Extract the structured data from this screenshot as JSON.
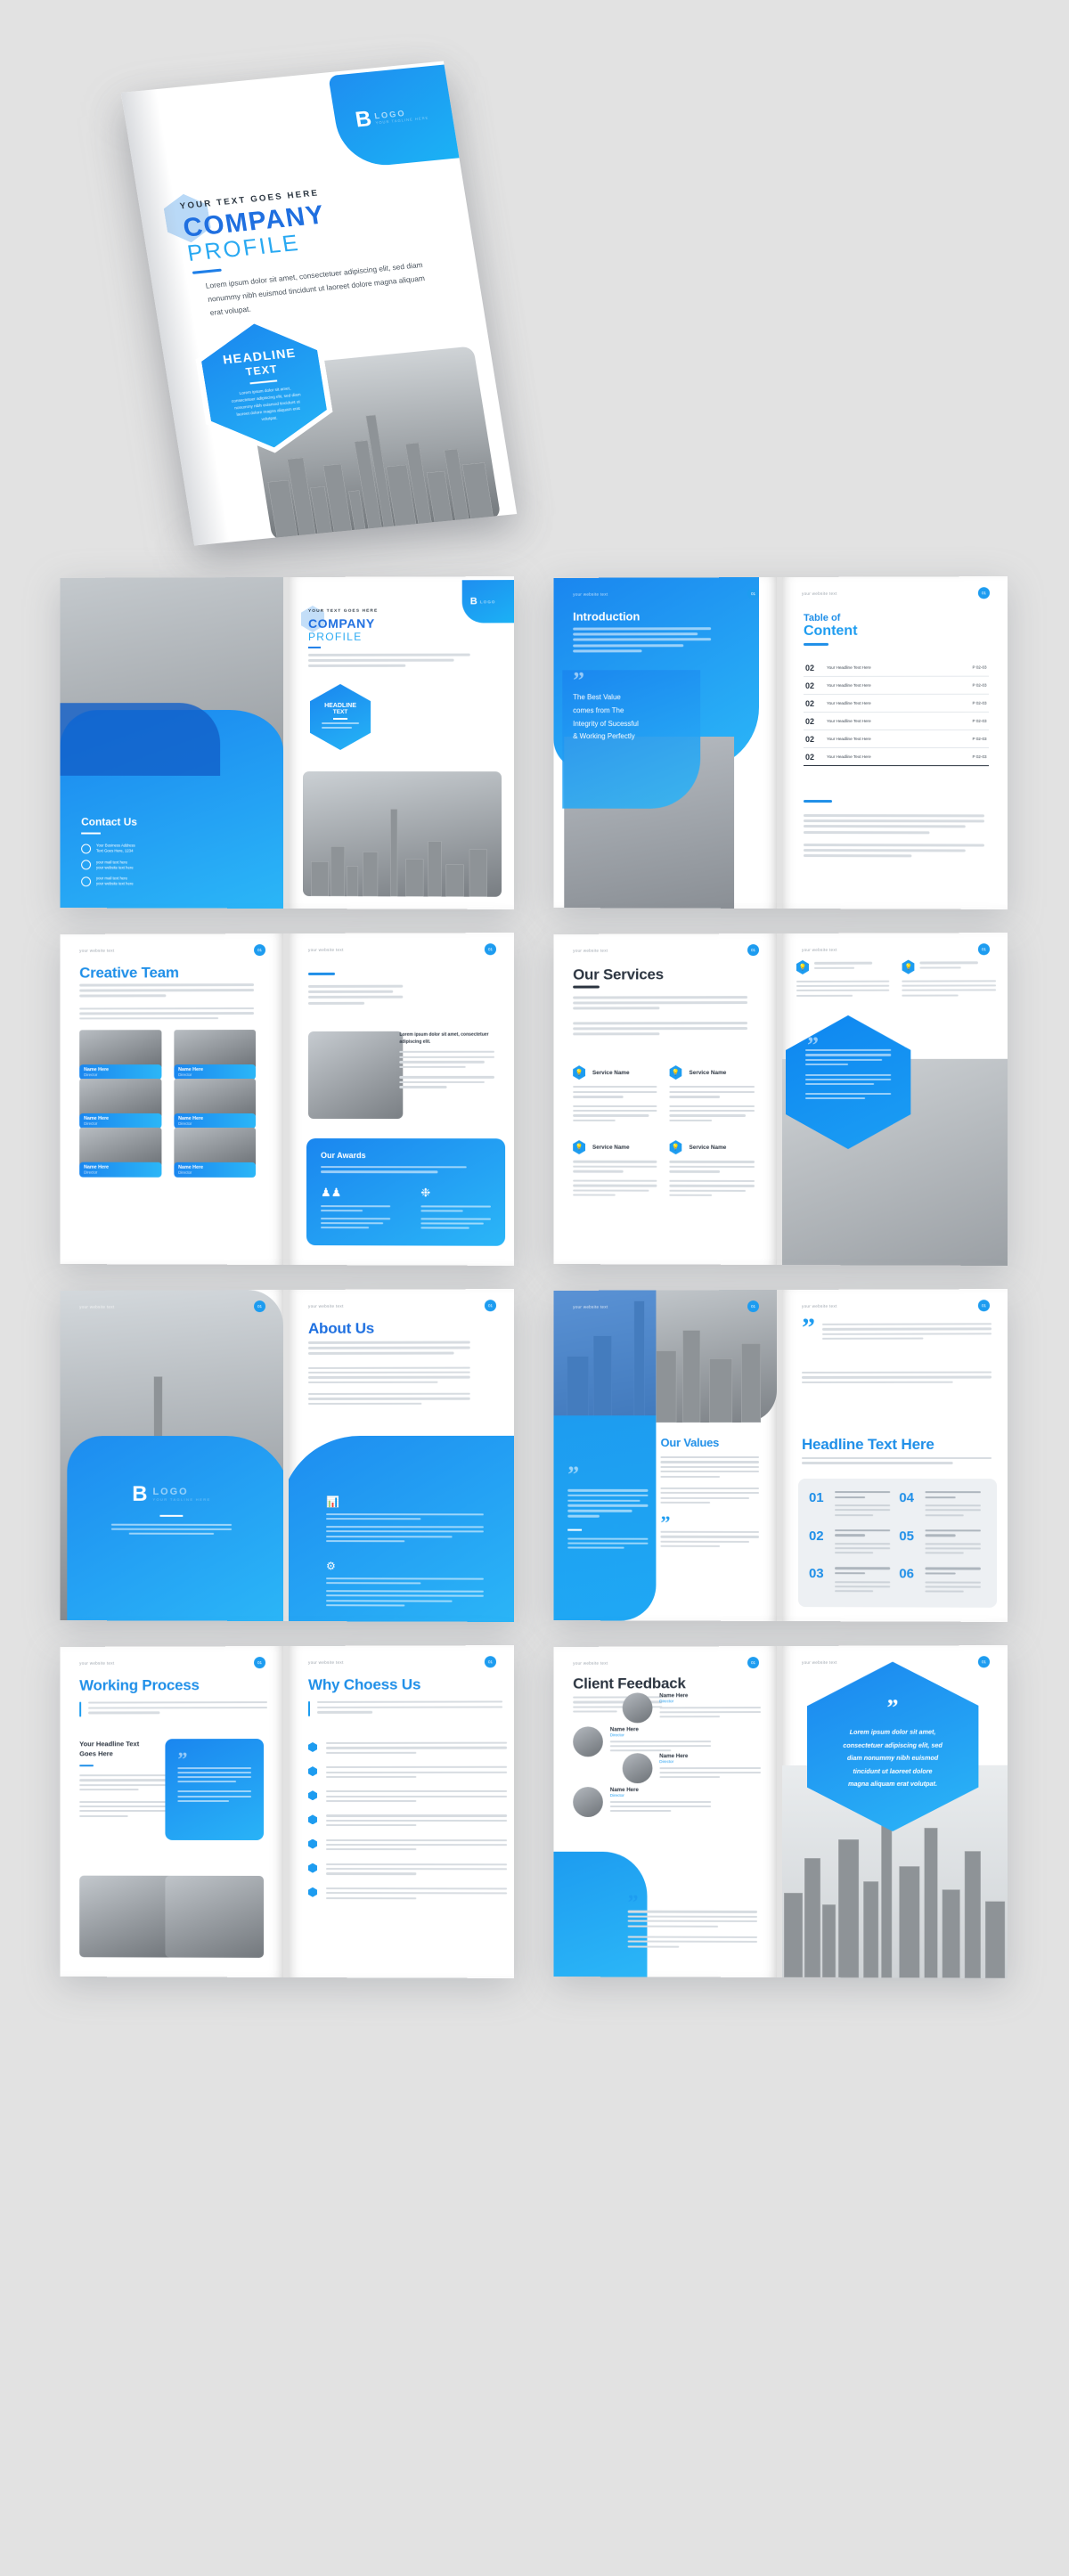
{
  "brand": {
    "primary": "#1f8fe8",
    "accent": "#25b4f6",
    "dark": "#2b3440",
    "logo_letter": "B",
    "logo_word": "LOGO",
    "logo_tagline": "YOUR TAGLINE HERE"
  },
  "cover": {
    "eyebrow": "YOUR TEXT GOES HERE",
    "title_line1": "COMPANY",
    "title_line2": "PROFILE",
    "body": "Lorem ipsum dolor sit amet, consectetuer adipiscing elit, sed diam nonummy nibh euismod tincidunt ut laoreet dolore magna aliquam erat volupat.",
    "headline_line1": "HEADLINE",
    "headline_line2": "TEXT",
    "headline_body": "Lorem ipsum dolor sit amet, consectetuer adipiscing elit, sed diam nonummy nibh euismod tincidunt ut laoreet dolore magna aliquam erat volutpat."
  },
  "common": {
    "website_text": "your website text",
    "page_number": "01"
  },
  "spreads": [
    {
      "id": "contact-cover",
      "left": {
        "name": "back-cover-contact",
        "title": "Contact Us",
        "items": [
          {
            "icon": "location-pin-icon",
            "line1": "Your Business Address",
            "line2": "Text Goes Here, 1234"
          },
          {
            "icon": "mail-icon",
            "line1": "your mail text here",
            "line2": "your website text here"
          },
          {
            "icon": "phone-icon",
            "line1": "your mail text here",
            "line2": "your website text here"
          }
        ]
      },
      "right": {
        "name": "front-cover",
        "eyebrow": "YOUR TEXT GOES HERE",
        "title_line1": "COMPANY",
        "title_line2": "PROFILE",
        "body": "Lorem ipsum dolor sit amet, consectetuer adipiscing elit, sed diam nonummy nibh euismod tincidunt ut laoreet dolore magna aliquam erat volutpat.",
        "headline_line1": "HEADLINE",
        "headline_line2": "TEXT",
        "logo_letter": "B",
        "logo_word": "LOGO"
      }
    },
    {
      "id": "introduction-toc",
      "left": {
        "name": "introduction-page",
        "title": "Introduction",
        "body": "Lorem ipsum dolor sit amet, consectetuer adipiscing elit, sed diam nonummy nibh euismod tincidunt ut laoreet dolore magna aliquam erat volutpat. Ut wisi enim ad minim veniam, quis nostrud exerci tation ullamcorper suscipit lobortis nisl ut aliquip ex ea commodo consequat.",
        "quote_line1": "The Best Value",
        "quote_line2": "comes from The",
        "quote_line3": "Integrity of Sucessful",
        "quote_line4": "& Working Perfectly"
      },
      "right": {
        "name": "table-of-content-page",
        "title_line1": "Table of",
        "title_line2": "Content",
        "rows": [
          {
            "num": "02",
            "title": "Your Headline Text Here",
            "page": "P 02-03"
          },
          {
            "num": "02",
            "title": "Your Headline Text Here",
            "page": "P 02-03"
          },
          {
            "num": "02",
            "title": "Your Headline Text Here",
            "page": "P 02-03"
          },
          {
            "num": "02",
            "title": "Your Headline Text Here",
            "page": "P 02-03"
          },
          {
            "num": "02",
            "title": "Your Headline Text Here",
            "page": "P 02-03"
          },
          {
            "num": "02",
            "title": "Your Headline Text Here",
            "page": "P 02-03"
          }
        ],
        "body1": "Lorem ipsum dolor sit amet, consectetuer adipiscing elit, sed diam nonummy nibh euismod tincidunt ut laoreet dolore magna aliquam erat volutpat.",
        "body2": "Lorem ipsum dolor sit amet, consectetuer adipiscing elit, sed diam nonummy nibh euismod tincidunt ut laoreet dolore magna aliquam erat volutpat."
      }
    },
    {
      "id": "team-awards",
      "left": {
        "name": "creative-team-page",
        "title": "Creative Team",
        "intro": "Lorem ipsum dolor sit amet, consectetuer adipiscing elit, sed diam nonummy nibh euismod tincidunt ut laoreet dolore magna aliquam erat volutpat, Ut wisi enim ad minim veniam.",
        "members": [
          {
            "name": "Name Here",
            "role": "Director"
          },
          {
            "name": "Name Here",
            "role": "Director"
          },
          {
            "name": "Name Here",
            "role": "Director"
          },
          {
            "name": "Name Here",
            "role": "Director"
          },
          {
            "name": "Name Here",
            "role": "Director"
          },
          {
            "name": "Name Here",
            "role": "Director"
          }
        ]
      },
      "right": {
        "name": "awards-page",
        "lead": "Lorem ipsum dolor sit amet, consectetuer adipiscing elit, sed diam nonummy nibh euismod tincidunt ut laoreet dolore magna aliquam erat volutpat",
        "side_heading": "Lorem ipsum dolor sit amet, consectetuer adipiscing elit.",
        "awards_title": "Our Awards",
        "awards_sub": "Lorem ipsum dolor sit amet, consectetuer adipiscing elit, sed diam nonummy nibh euismod tincidunt ut laoreet dolore magna aliquam erat volutpat.",
        "awards": [
          {
            "icon": "team-icon",
            "label": "Lorem ipsum dolor sit amet, consectetuer adipiscing elit"
          },
          {
            "icon": "award-badge-icon",
            "label": "Lorem ipsum dolor sit amet, consectetuer adipiscing elit"
          }
        ]
      }
    },
    {
      "id": "services-testimonial",
      "left": {
        "name": "our-services-page",
        "title": "Our Services",
        "body1": "Lorem ipsum dolor sit amet, consectetuer adipiscing elit, sed diam nonummy nibh euismod tincidunt ut laoreet dolore magna aliquam erat volutpat. Ut wisi enim ad minim veniam.",
        "body2": "Lorem ipsum dolor sit amet, consectetuer adipiscing elit, sed diam nonummy nibh euismod tincidunt ut laoreet dolore magna aliquam erat volutpat. Ut wisi enim ad minim veniam.",
        "services": [
          {
            "icon": "lightbulb-icon",
            "name": "Service Name"
          },
          {
            "icon": "lightbulb-icon",
            "name": "Service Name"
          },
          {
            "icon": "lightbulb-icon",
            "name": "Service Name"
          },
          {
            "icon": "lightbulb-icon",
            "name": "Service Name"
          }
        ]
      },
      "right": {
        "name": "testimonial-page",
        "cards": [
          {
            "icon": "lightbulb-icon",
            "label": "Lorem ipsum dolor sit amet, consectetuer adipiscing elit"
          },
          {
            "icon": "lightbulb-icon",
            "label": "Lorem ipsum dolor sit amet, consectetuer adipiscing elit"
          }
        ],
        "hex_quote": "Lorem ipsum dolor sit amet, consectetuer adipiscing elit, sed diam nonummy nibh euismod tincidunt ut laoreet dolore magna aliquam erat volutpat."
      }
    },
    {
      "id": "logo-about",
      "left": {
        "name": "logo-page",
        "logo_letter": "B",
        "logo_word": "LOGO",
        "logo_tagline": "YOUR TAGLINE HERE",
        "body": "Lorem ipsum dolor sit amet, consectetuer adipiscing elit, sed diam nonummy nibh euismod tincidunt ut laoreet dolore magna aliquam erat volutpat."
      },
      "right": {
        "name": "about-us-page",
        "title": "About Us",
        "lead": "Lorem ipsum dolor sit amet, consectetuer adipiscing elit, sed diam nonummy nibh euismod tincidunt ut laoreet dolore magna aliquam erat volutpat.",
        "features": [
          {
            "icon": "presentation-chart-icon",
            "label": "Lorem ipsum dolor sit amet, consectetuer adipiscing elit"
          },
          {
            "icon": "team-network-icon",
            "label": "Lorem ipsum dolor sit amet, consectetuer adipiscing elit"
          }
        ]
      }
    },
    {
      "id": "values-headline",
      "left": {
        "name": "our-values-page",
        "title": "Our Values",
        "quote": "Lorem ipsum dolor sit amet, consectetuer adipiscing elit, sed diam nonummy nibh euismod tincidunt ut laoreet dolore magna aliquam erat volutpat.",
        "body": "Lorem ipsum dolor sit amet, consectetuer adipiscing elit, sed diam nonummy nibh euismod tincidunt ut laoreet dolore magna aliquam erat volutpat."
      },
      "right": {
        "name": "headline-numbers-page",
        "title": "Headline Text Here",
        "intro": "Lorem ipsum dolor sit amet, consectetuer adipiscing elit, sed diam nonummy nibh euismod tincidunt ut laoreet dolore magna aliquam erat volutpat.",
        "items": [
          {
            "num": "01",
            "heading": "Lorem ipsum dolor sit amet, consectetuer adipiscing elit."
          },
          {
            "num": "02",
            "heading": "Lorem ipsum dolor sit amet, consectetuer adipiscing elit."
          },
          {
            "num": "03",
            "heading": "Lorem ipsum dolor sit amet, consectetuer adipiscing elit."
          },
          {
            "num": "04",
            "heading": "Lorem ipsum dolor sit amet, consectetuer adipiscing elit."
          },
          {
            "num": "05",
            "heading": "Lorem ipsum dolor sit amet, consectetuer adipiscing elit."
          },
          {
            "num": "06",
            "heading": "Lorem ipsum dolor sit amet, consectetuer adipiscing elit."
          }
        ]
      }
    },
    {
      "id": "process-why",
      "left": {
        "name": "working-process-page",
        "title": "Working Process",
        "lead": "Lorem ipsum dolor sit amet, consectetuer adipiscing elit, sed diam nonummy nibh euismod tincidunt ut laoreet dolore magna aliquam erat volutpat, Ut wisi enim ad minim veniam.",
        "sub_title_line1": "Your Headline Text",
        "sub_title_line2": "Goes Here",
        "quote_card": "Lorem ipsum dolor sit amet, consectetuer adipiscing elit, sed diam nonummy nibh euismod tincidunt ut laoreet dolore magna aliquam erat volutpat."
      },
      "right": {
        "name": "why-choose-us-page",
        "title": "Why Choess Us",
        "lead": "Lorem ipsum dolor sit amet, consectetuer adipiscing elit, sed diam nonummy nibh euismod tincidunt ut laoreet dolore magna aliquam erat volutpat, Ut wisi enim ad minim veniam.",
        "bullets": [
          "Lorem ipsum dolor sit amet, consectetuer adipiscing elit, sed diam nonummy nibh euismod tincidunt ut laoreet dolore magna aliquam erat volutpat.",
          "Lorem ipsum dolor sit amet, consectetuer adipiscing elit, sed diam nonummy nibh euismod tincidunt ut laoreet dolore magna aliquam erat volutpat.",
          "Lorem ipsum dolor sit amet, consectetuer adipiscing elit, sed diam nonummy nibh euismod tincidunt ut laoreet dolore magna aliquam erat volutpat.",
          "Lorem ipsum dolor sit amet, consectetuer adipiscing elit, sed diam nonummy nibh euismod tincidunt ut laoreet dolore magna aliquam erat volutpat.",
          "Lorem ipsum dolor sit amet, consectetuer adipiscing elit, sed diam nonummy nibh euismod tincidunt ut laoreet dolore magna aliquam erat volutpat.",
          "Lorem ipsum dolor sit amet, consectetuer adipiscing elit, sed diam nonummy nibh euismod tincidunt ut laoreet dolore magna aliquam erat volutpat.",
          "Lorem ipsum dolor sit amet, consectetuer adipiscing elit, sed diam nonummy nibh euismod tincidunt ut laoreet dolore magna aliquam erat volutpat."
        ]
      }
    },
    {
      "id": "feedback-quote",
      "left": {
        "name": "client-feedback-page",
        "title": "Client Feedback",
        "intro": "Lorem ipsum dolor sit amet, consectetuer adipiscing elit, sed diam nonummy nibh euismod tincidunt ut laoreet dolore magna aliquam erat volutpat.",
        "clients": [
          {
            "name": "Name Here",
            "role": "Director"
          },
          {
            "name": "Name Here",
            "role": "Director"
          },
          {
            "name": "Name Here",
            "role": "Director"
          },
          {
            "name": "Name Here",
            "role": "Director"
          }
        ],
        "quote": "Lorem ipsum dolor sit amet, consectetuer adipiscing elit, sed diam nonummy nibh euismod tincidunt ut laoreet dolore magna aliquam erat volutpat."
      },
      "right": {
        "name": "closing-quote-page",
        "quote": "Lorem ipsum dolor sit amet, consectetuer adipiscing elit, sed diam nonummy nibh euismod tincidunt ut laoreet dolore magna aliquam erat volutpat."
      }
    }
  ]
}
